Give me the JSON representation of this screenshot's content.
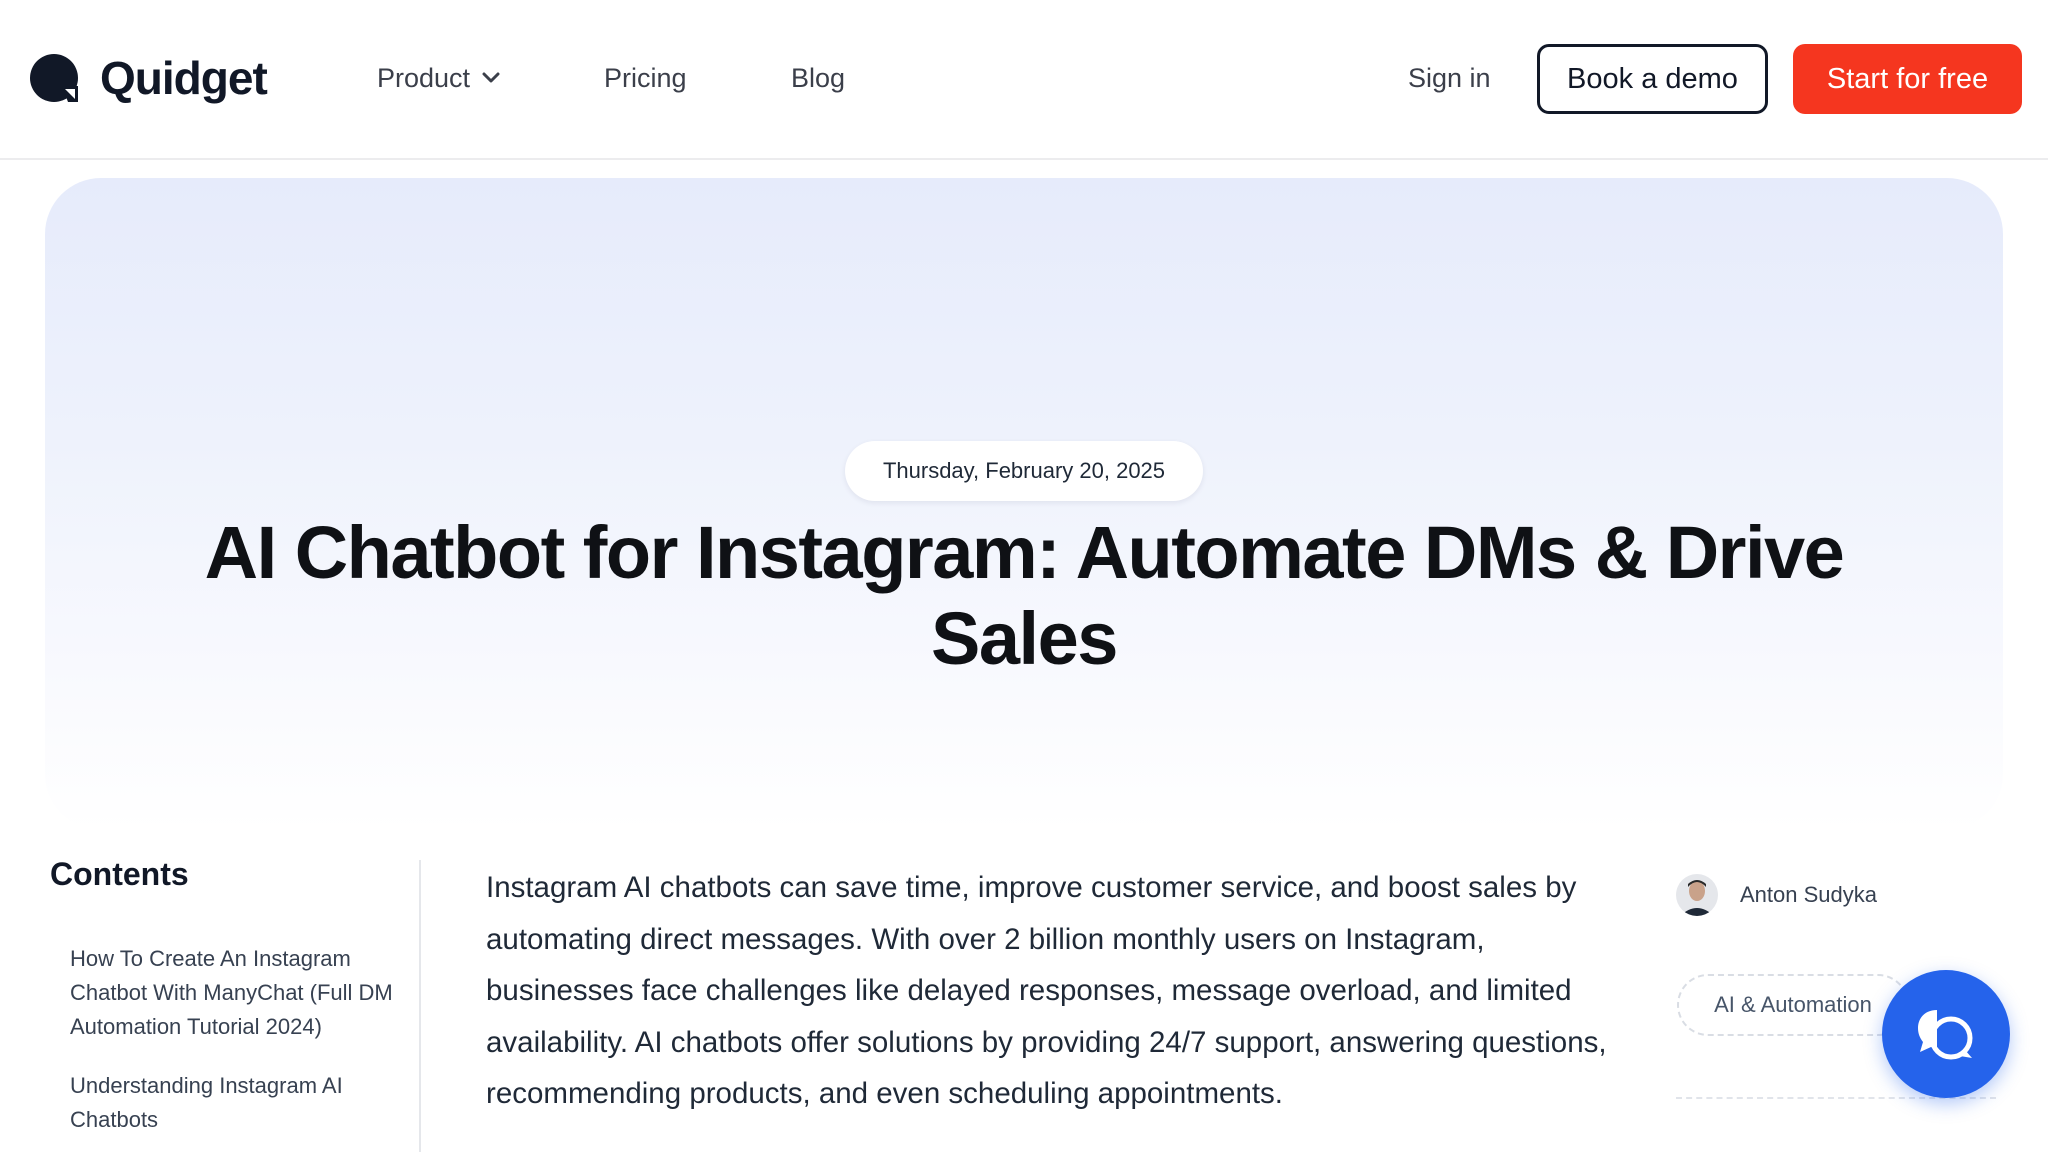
{
  "header": {
    "brand": "Quidget",
    "nav": {
      "product": "Product",
      "pricing": "Pricing",
      "blog": "Blog"
    },
    "sign_in": "Sign in",
    "book_demo": "Book a demo",
    "start_free": "Start for free"
  },
  "hero": {
    "date": "Thursday, February 20, 2025",
    "title": "AI Chatbot for Instagram: Automate DMs & Drive Sales"
  },
  "sidebar": {
    "title": "Contents",
    "items": [
      {
        "label": "How To Create An Instagram Chatbot With ManyChat (Full DM Automation Tutorial 2024)"
      },
      {
        "label": "Understanding Instagram AI Chatbots"
      }
    ]
  },
  "article": {
    "intro": "Instagram AI chatbots can save time, improve customer service, and boost sales by automating direct messages. With over 2 billion monthly users on Instagram, businesses face challenges like delayed responses, message overload, and limited availability. AI chatbots offer solutions by providing 24/7 support, answering questions, recommending products, and even scheduling appointments."
  },
  "meta": {
    "author": "Anton Sudyka",
    "tag": "AI & Automation"
  },
  "icons": {
    "logo": "quidget-logo-icon",
    "product_chevron": "chevron-down-icon",
    "chat": "chat-bubble-icon"
  },
  "colors": {
    "accent": "#f5361f",
    "chat_button": "#2563eb",
    "text_dark": "#111827"
  }
}
